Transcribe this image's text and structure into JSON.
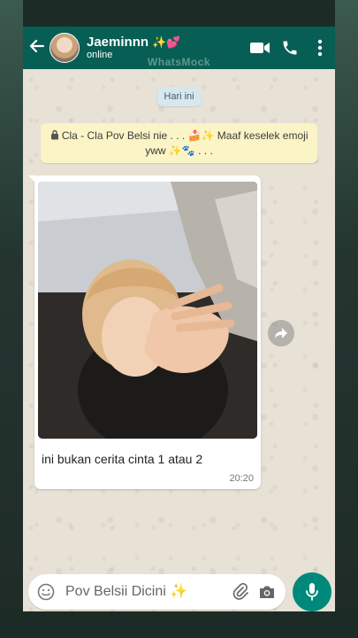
{
  "header": {
    "contact_name": "Jaeminnn",
    "name_decoration_spark": "✨",
    "name_decoration_heart": "💕",
    "status": "online",
    "brand_watermark": "WhatsMock",
    "bg_color": "#075e54"
  },
  "chat": {
    "date_chip": "Hari ini",
    "notice": "Cla - Cla Pov Belsi nie . . . 🍰✨ Maaf keselek emoji yww ✨🐾 . . .",
    "message": {
      "caption": "ini bukan cerita cinta 1 atau 2",
      "time": "20:20"
    }
  },
  "input": {
    "placeholder": "Pov Belsii Dicini ✨"
  },
  "icons": {
    "back": "arrow-left-icon",
    "video": "video-call-icon",
    "call": "phone-icon",
    "menu": "more-vert-icon",
    "emoji": "emoji-icon",
    "attach": "paperclip-icon",
    "camera": "camera-icon",
    "mic": "mic-icon",
    "forward": "forward-icon",
    "lock": "lock-icon"
  },
  "colors": {
    "accent": "#00897b",
    "notice_bg": "#fbf4c6",
    "date_chip_bg": "#d5e8f0"
  }
}
